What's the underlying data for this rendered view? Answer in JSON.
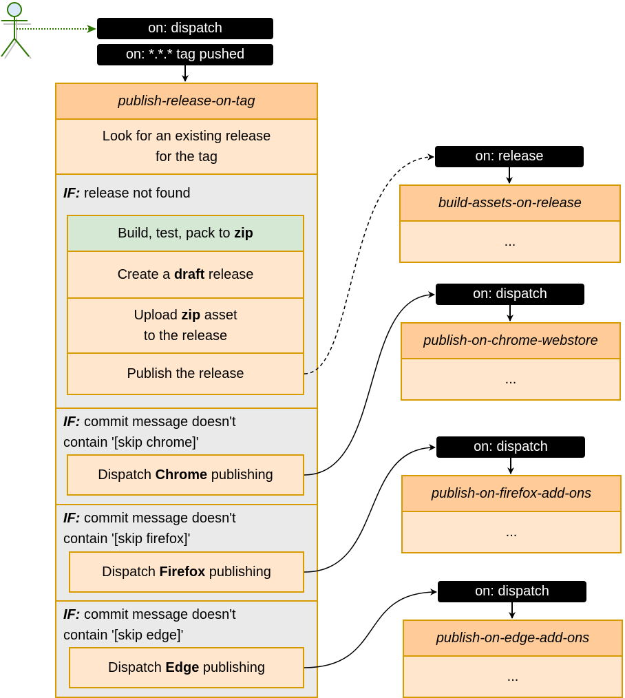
{
  "actor": {
    "icon": "stick-figure-actor-icon"
  },
  "main_triggers": [
    {
      "label": "on: dispatch"
    },
    {
      "label": "on: *.*.* tag pushed"
    }
  ],
  "main_workflow": {
    "title": "publish-release-on-tag",
    "first_step": [
      "Look for an existing release",
      "for the tag"
    ],
    "conditions": [
      {
        "if_label": "IF:",
        "text": "release not found",
        "steps": [
          {
            "pre": "Build, test, pack to ",
            "bold": "zip",
            "post": "",
            "color": "#d5e8d4"
          },
          {
            "pre": "Create a ",
            "bold": "draft",
            "post": " release",
            "color": "#ffe6cc"
          },
          {
            "pre": "Upload ",
            "bold": "zip",
            "post": " asset",
            "line2": "to the release",
            "color": "#ffe6cc"
          },
          {
            "pre": "Publish the release",
            "bold": "",
            "post": "",
            "color": "#ffe6cc"
          }
        ]
      },
      {
        "if_label": "IF:",
        "text": "commit message doesn't",
        "text2": "contain '[skip chrome]'",
        "steps": [
          {
            "pre": "Dispatch ",
            "bold": "Chrome",
            "post": " publishing"
          }
        ]
      },
      {
        "if_label": "IF:",
        "text": "commit message doesn't",
        "text2": "contain '[skip firefox]'",
        "steps": [
          {
            "pre": "Dispatch ",
            "bold": "Firefox",
            "post": " publishing"
          }
        ]
      },
      {
        "if_label": "IF:",
        "text": "commit message doesn't",
        "text2": "contain '[skip edge]'",
        "steps": [
          {
            "pre": "Dispatch ",
            "bold": "Edge",
            "post": " publishing"
          }
        ]
      }
    ]
  },
  "side_workflows": [
    {
      "trigger": "on: release",
      "title": "build-assets-on-release",
      "body": "..."
    },
    {
      "trigger": "on: dispatch",
      "title": "publish-on-chrome-webstore",
      "body": "..."
    },
    {
      "trigger": "on: dispatch",
      "title": "publish-on-firefox-add-ons",
      "body": "..."
    },
    {
      "trigger": "on: dispatch",
      "title": "publish-on-edge-add-ons",
      "body": "..."
    }
  ],
  "colors": {
    "trigger_bg": "#000000",
    "header_bg": "#ffcc99",
    "body_bg": "#ffe6cc",
    "border": "#d79b00",
    "condition_bg": "#eaeaea",
    "build_step_bg": "#d5e8d4",
    "actor_stroke": "#2d7600",
    "actor_fill": "#dae8fc"
  }
}
